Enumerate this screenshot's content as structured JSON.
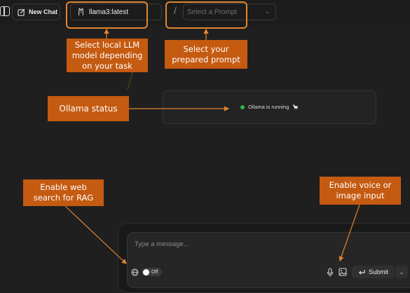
{
  "header": {
    "new_chat_label": "New Chat",
    "model_value": "llama3:latest",
    "divider": "/",
    "prompt_placeholder": "Select a Prompt"
  },
  "status": {
    "text": "Ollama is running",
    "llama_glyph": "🦙",
    "dot_color": "#2fb44f"
  },
  "composer": {
    "placeholder": "Type a message...",
    "web_toggle_label": "Off",
    "submit_label": "Submit"
  },
  "annotations": {
    "model": "Select local LLM model depending on your task",
    "prompt": "Select your prepared  prompt",
    "ollama": "Ollama status",
    "web": "Enable web search for RAG",
    "voice": "Enable voice or image input"
  },
  "colors": {
    "callout": "#c55a11",
    "callout_outline": "#e2852e",
    "background": "#1f1f1f"
  },
  "icons": {
    "sidebar": "sidebar-toggle-icon",
    "new_chat": "pencil-square-icon",
    "model": "ollama-llama-icon",
    "chevron": "chevron-down-icon",
    "globe": "globe-icon",
    "mic": "microphone-icon",
    "image": "image-icon",
    "submit": "enter-return-icon"
  }
}
